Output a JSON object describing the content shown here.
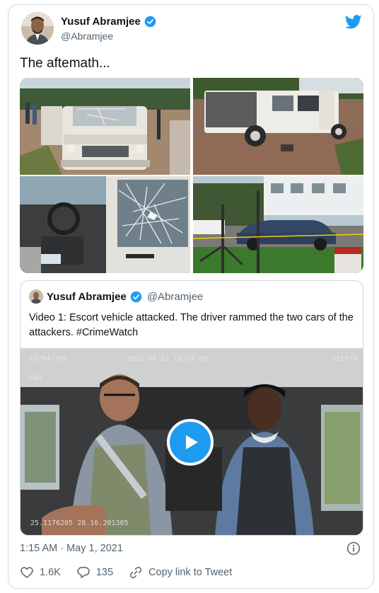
{
  "tweet": {
    "author_name": "Yusuf Abramjee",
    "author_handle": "@Abramjee",
    "text": "The aftemath...",
    "timestamp": "1:15 AM · May 1, 2021"
  },
  "photos": [
    {
      "icon": "white-suv-front-shattered-windshield"
    },
    {
      "icon": "white-suv-side-door-open"
    },
    {
      "icon": "suv-interior-shattered-window"
    },
    {
      "icon": "car-park-dark-sedan"
    }
  ],
  "quote": {
    "author_name": "Yusuf Abramjee",
    "author_handle": "@Abramjee",
    "text": "Video 1: Escort vehicle attacked. The driver rammed the two cars of the attackers. #CrimeWatch",
    "video": {
      "overlay_top_left": "17/04/TRP",
      "overlay_top_center": "2021-04-22  10:24:00",
      "overlay_top_right": "S1EP/8",
      "overlay_cab": "Cab",
      "overlay_bottom": "25.1176205  28.16.201305"
    }
  },
  "actions": {
    "likes": "1.6K",
    "replies": "135",
    "copy_link": "Copy link to Tweet"
  },
  "colors": {
    "accent": "#1d9bf0",
    "secondary_text": "#536471",
    "border": "#cfd9de"
  }
}
